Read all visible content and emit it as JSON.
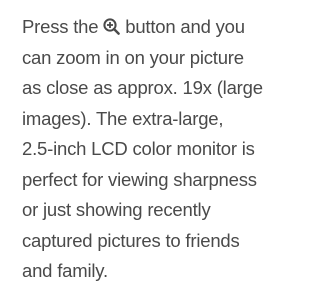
{
  "paragraph": {
    "lines": [
      {
        "before": "Press the ",
        "after": " button and you"
      },
      {
        "text": "can zoom in on your picture"
      },
      {
        "text": "as close as approx. 19x (large"
      },
      {
        "text": "images). The extra-large,"
      },
      {
        "text": "2.5-inch LCD color monitor is"
      },
      {
        "text": "perfect for viewing sharpness"
      },
      {
        "text": "or just showing recently"
      },
      {
        "text": "captured pictures to friends"
      },
      {
        "text": "and family."
      }
    ],
    "inline_icon": "zoom-in-magnifier-icon"
  },
  "colors": {
    "text": "#4a4a4a",
    "background": "#ffffff"
  }
}
